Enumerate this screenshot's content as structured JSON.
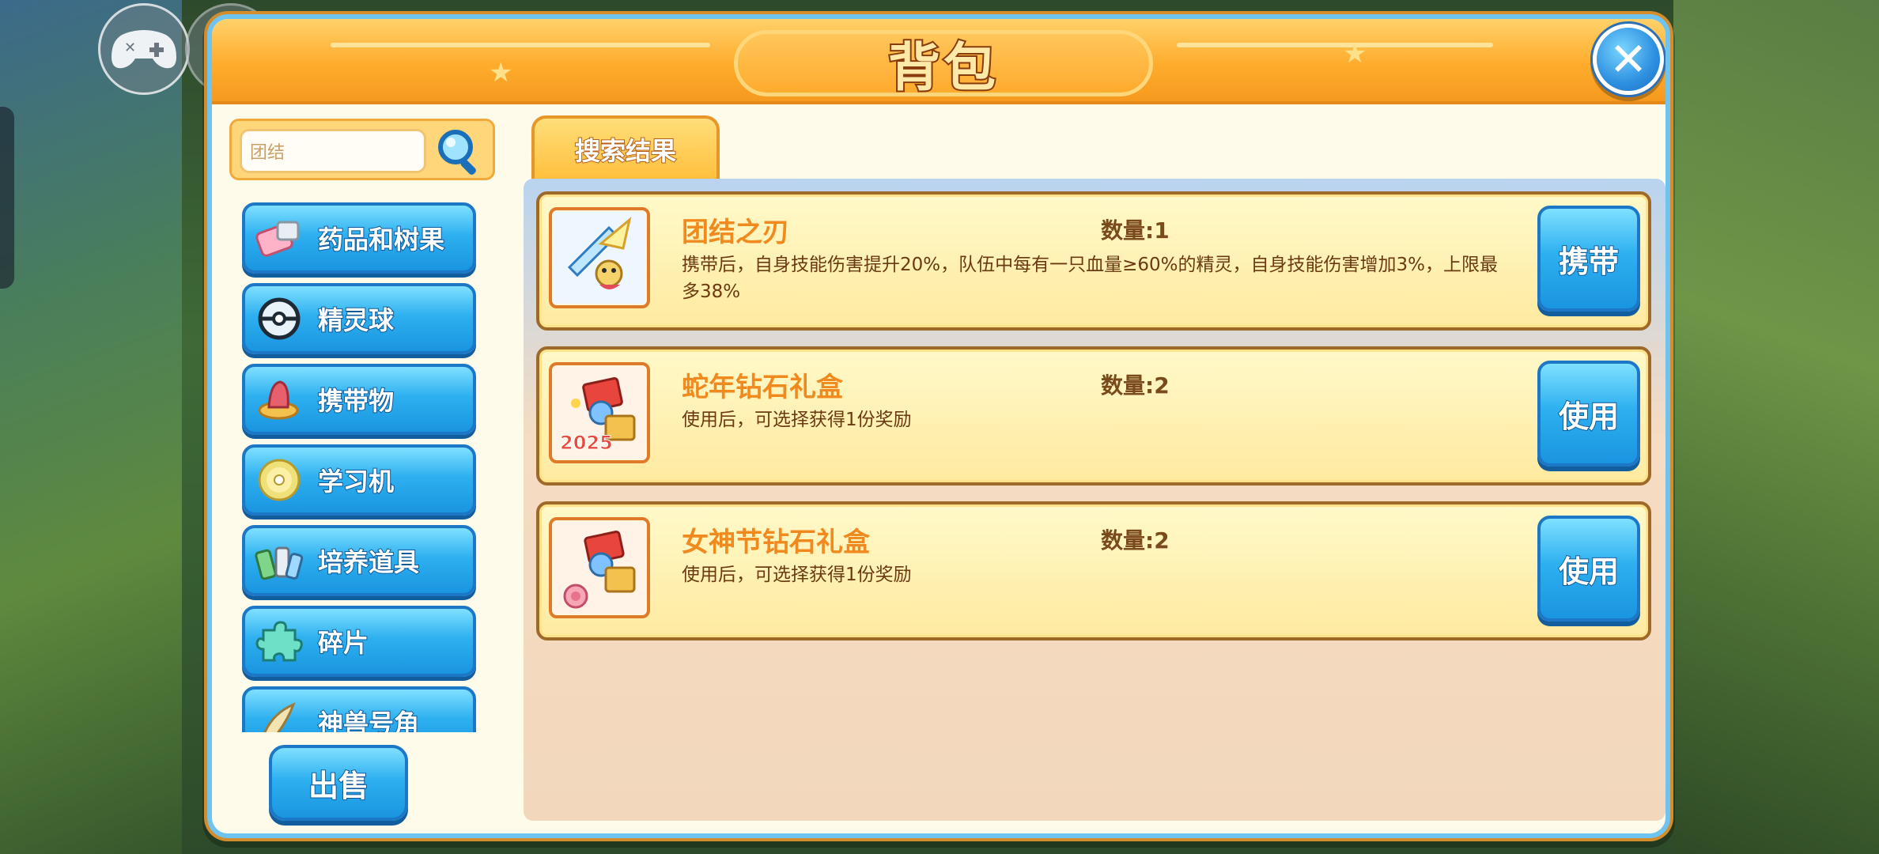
{
  "window": {
    "title": "背包"
  },
  "overlay": {
    "left_icon": "gamepad-icon",
    "right_icon": "rocket-icon"
  },
  "search": {
    "value": "团结",
    "icon": "magnifier-icon"
  },
  "categories": [
    {
      "label": "药品和树果",
      "icon": "medicine-icon"
    },
    {
      "label": "精灵球",
      "icon": "pokeball-icon"
    },
    {
      "label": "携带物",
      "icon": "held-item-icon"
    },
    {
      "label": "学习机",
      "icon": "disc-icon"
    },
    {
      "label": "培养道具",
      "icon": "training-tools-icon"
    },
    {
      "label": "碎片",
      "icon": "puzzle-icon"
    },
    {
      "label": "神兽号角",
      "icon": "horn-icon"
    }
  ],
  "sell_button": "出售",
  "tabs": [
    {
      "label": "搜索结果",
      "active": true
    }
  ],
  "items": [
    {
      "name": "团结之刃",
      "quantity": "数量:1",
      "description": "携带后，自身技能伤害提升20%，队伍中每有一只血量≥60%的精灵，自身技能伤害增加3%，上限最多38%",
      "action": "携带",
      "icon": "blade-creature-icon"
    },
    {
      "name": "蛇年钻石礼盒",
      "quantity": "数量:2",
      "description": "使用后，可选择获得1份奖励",
      "action": "使用",
      "icon": "gift-box-2025-icon"
    },
    {
      "name": "女神节钻石礼盒",
      "quantity": "数量:2",
      "description": "使用后，可选择获得1份奖励",
      "action": "使用",
      "icon": "gift-box-flower-icon"
    }
  ],
  "colors": {
    "header_orange": "#ffac2d",
    "button_blue": "#2eb0f0",
    "item_name_orange": "#f08a1e",
    "panel_border_blue": "#6ec4ee"
  }
}
